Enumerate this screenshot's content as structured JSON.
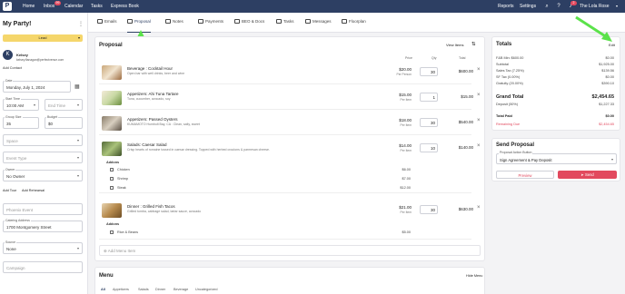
{
  "nav": {
    "links": [
      "Home",
      "Inbox",
      "Calendar",
      "Tasks",
      "Express Book"
    ],
    "inbox_badge": "99",
    "right_links": [
      "Reports",
      "Settings"
    ],
    "notif_badge": "2",
    "user": "The Lola Rose"
  },
  "left": {
    "title": "My Party!",
    "status": "Lead",
    "client_initial": "K",
    "client_name": "Kelsey",
    "client_email": "kelsey.flanagan@perfectvenue.com",
    "add_contact": "Add Contact",
    "date_label": "Date",
    "date_value": "Monday, July 1, 2024",
    "start_label": "Start Time",
    "start_value": "10:00 AM",
    "end_placeholder": "End Time",
    "group_label": "Group Size",
    "group_value": "35",
    "budget_label": "Budget",
    "budget_value": "$0",
    "space_placeholder": "Space",
    "event_type_placeholder": "Event Type",
    "owner_label": "Owner",
    "owner_value": "No Owner",
    "add_tour": "Add Tour",
    "add_rehearsal": "Add Rehearsal",
    "phoenix_placeholder": "Phoenix Event",
    "catering_label": "Catering Address",
    "catering_value": "1700 Montgomery Street",
    "source_label": "Source",
    "source_value": "None",
    "campaign_placeholder": "Campaign"
  },
  "tabs": [
    "Emails",
    "Proposal",
    "Notes",
    "Payments",
    "BEO & Docs",
    "Tasks",
    "Messages",
    "Floorplan"
  ],
  "proposal": {
    "title": "Proposal",
    "view_items": "View Items",
    "col_price": "Price",
    "col_qty": "Qty",
    "col_total": "Total",
    "items": [
      {
        "name": "Beverage : Cocktail Hour",
        "desc": "Open bar with well drinks, beer and wine",
        "price": "$20.00",
        "unit": "Per Person",
        "qty": "30",
        "total": "$600.00"
      },
      {
        "name": "Appetizers: Ahi Tuna Tartare",
        "desc": "Tuna, cucumber, avocado, soy",
        "price": "$15.00",
        "unit": "Per Item",
        "qty": "1",
        "total": "$15.00"
      },
      {
        "name": "Appetizers: Passed Oysters",
        "desc": "KUMAMOTO Humbolt Bay, CA : Clean, salty, sweet",
        "price": "$18.00",
        "unit": "Per Item",
        "qty": "30",
        "total": "$540.00"
      },
      {
        "name": "Salads: Caesar Salad",
        "desc": "Crisp hearts of romaine tossed in caesar dressing. Topped with herbed croutons & parmesan cheese.",
        "price": "$14.00",
        "unit": "Per Item",
        "qty": "10",
        "total": "$140.00"
      },
      {
        "name": "Dinner : Grilled Fish Tacos",
        "desc": "Grilled tomba, cabbage salad, tartar sauce, avocado",
        "price": "$21.00",
        "unit": "Per Item",
        "qty": "30",
        "total": "$630.00"
      }
    ],
    "addons_label": "Addons",
    "addons1": [
      {
        "name": "Chicken",
        "price": "$6.00"
      },
      {
        "name": "Shrimp",
        "price": "$7.00"
      },
      {
        "name": "Steak",
        "price": "$12.00"
      }
    ],
    "addons2": [
      {
        "name": "Rice & Beans",
        "price": "$5.00"
      }
    ],
    "add_menu_item": "Add Menu Item"
  },
  "menu": {
    "title": "Menu",
    "hide": "Hide Menu",
    "tabs": [
      "All",
      "Appetizers",
      "Salads",
      "Dinner",
      "Beverage",
      "Uncategorized"
    ]
  },
  "totals": {
    "title": "Totals",
    "edit": "Edit",
    "rows": [
      {
        "label": "F&B Min: $600.00",
        "value": "$0.00"
      },
      {
        "label": "Subtotal",
        "value": "$1,925.00"
      },
      {
        "label": "Sales Tax (7.25%)",
        "value": "$139.56"
      },
      {
        "label": "SF Tax (0.00%)",
        "value": "$0.00"
      },
      {
        "label": "Gratuity (20.00%)",
        "value": "$390.10"
      }
    ],
    "grand_label": "Grand Total",
    "grand_value": "$2,454.65",
    "deposit_label": "Deposit (50%)",
    "deposit_value": "$1,227.33",
    "paid_label": "Total Paid",
    "paid_value": "$0.00",
    "remaining_label": "Remaining Due",
    "remaining_value": "$2,454.65"
  },
  "send": {
    "title": "Send Proposal",
    "action_label": "Proposal Action Button",
    "action_value": "Sign Agreement & Pay Deposit",
    "preview": "Preview",
    "send": "Send"
  },
  "colors": {
    "nav": "#2d3f63",
    "lead": "#f5d66b",
    "send_btn": "#e2495e",
    "arrow": "#5be24a",
    "remaining": "#e2495e"
  }
}
